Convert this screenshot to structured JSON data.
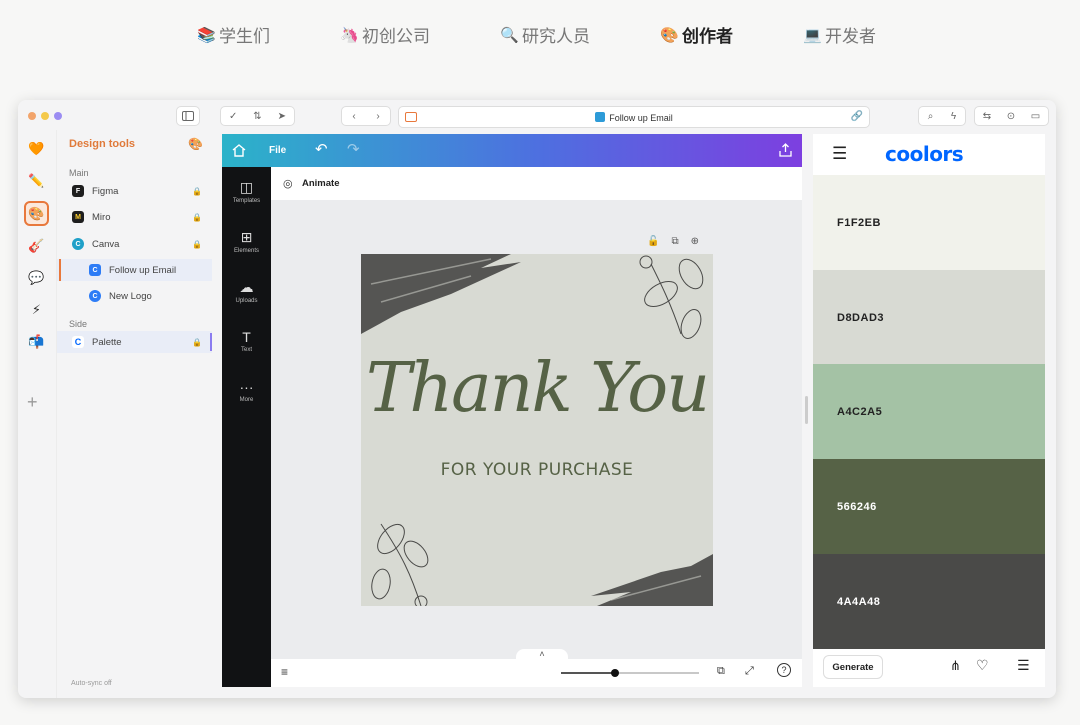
{
  "category_tabs": [
    {
      "icon": "📚",
      "label": "学生们"
    },
    {
      "icon": "🦄",
      "label": "初创公司"
    },
    {
      "icon": "🔍",
      "label": "研究人员"
    },
    {
      "icon": "🎨",
      "label": "创作者"
    },
    {
      "icon": "💻",
      "label": "开发者"
    }
  ],
  "active_tab": "创作者",
  "window": {
    "traffic_colors": [
      "#f2a46b",
      "#f4c94a",
      "#9b8cf2"
    ],
    "url_title": "Follow up Email"
  },
  "rail": {
    "items": [
      {
        "icon": "🧡"
      },
      {
        "icon": "✏️"
      },
      {
        "icon": "🎨"
      },
      {
        "icon": "🎸"
      },
      {
        "icon": "💬"
      },
      {
        "icon": "⚡"
      },
      {
        "icon": "📬"
      }
    ],
    "add": "+",
    "help": "?"
  },
  "sidebar": {
    "title": "Design tools",
    "title_icon": "🎨",
    "main_label": "Main",
    "items": [
      {
        "label": "Figma",
        "icon_text": "F",
        "color": "#1e1e1e"
      },
      {
        "label": "Miro",
        "icon_text": "M",
        "color": "#1e1e1e"
      },
      {
        "label": "Canva",
        "icon_text": "C",
        "color": "#1fa0c8"
      },
      {
        "label": "Follow up Email",
        "icon_text": "C",
        "color": "#2d7cf6"
      },
      {
        "label": "New Logo",
        "icon_text": "C",
        "color": "#2d7cf6"
      }
    ],
    "side_label": "Side",
    "side_items": [
      {
        "label": "Palette",
        "icon_text": "C",
        "color": "#0066ff"
      }
    ],
    "footer": "Auto-sync off"
  },
  "canva": {
    "file_label": "File",
    "animate_label": "Animate",
    "tools": [
      "Templates",
      "Elements",
      "Uploads",
      "Text",
      "More"
    ],
    "card_title": "Thank You",
    "card_subtitle": "FOR YOUR PURCHASE"
  },
  "coolors": {
    "logo": "coolors",
    "swatches": [
      {
        "hex": "F1F2EB",
        "color": "#F1F2EB",
        "text_color": "#222222"
      },
      {
        "hex": "D8DAD3",
        "color": "#D8DAD3",
        "text_color": "#222222"
      },
      {
        "hex": "A4C2A5",
        "color": "#A4C2A5",
        "text_color": "#222222"
      },
      {
        "hex": "566246",
        "color": "#566246",
        "text_color": "#ffffff"
      },
      {
        "hex": "4A4A48",
        "color": "#4A4A48",
        "text_color": "#ffffff"
      }
    ],
    "generate_label": "Generate"
  }
}
